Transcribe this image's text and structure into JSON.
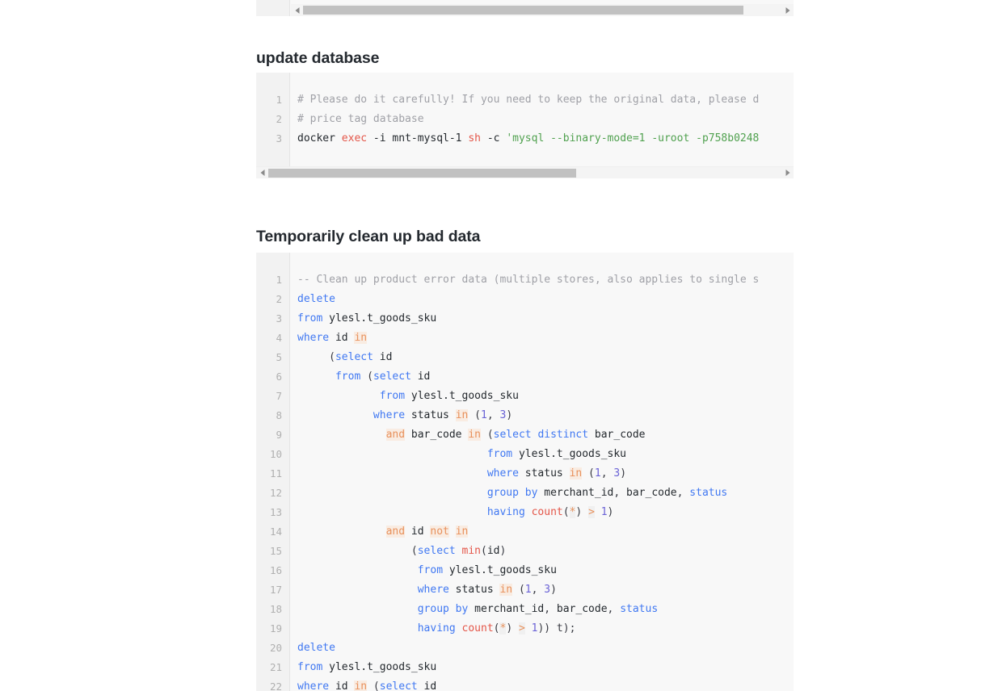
{
  "page": {
    "sections": [
      {
        "id": "update-database",
        "heading": "update database"
      },
      {
        "id": "clean-bad-data",
        "heading": "Temporarily clean up bad data"
      }
    ]
  },
  "top_clipped_block": {
    "scrollbar": {
      "left_arrow": "◀",
      "right_arrow": "▶",
      "thumb_left_pct": 0,
      "thumb_width_pct": 92
    }
  },
  "shell_block": {
    "language": "shell",
    "line_numbers": [
      "1",
      "2",
      "3"
    ],
    "lines": [
      {
        "n": "1",
        "tokens": [
          {
            "t": "# Please do it carefully! If you need to keep the original data, please d",
            "c": "t-comment"
          }
        ]
      },
      {
        "n": "2",
        "tokens": [
          {
            "t": "# price tag database",
            "c": "t-comment"
          }
        ]
      },
      {
        "n": "3",
        "tokens": [
          {
            "t": "docker ",
            "c": "t-plain"
          },
          {
            "t": "exec",
            "c": "t-red"
          },
          {
            "t": " -i mnt-mysql-1 ",
            "c": "t-plain"
          },
          {
            "t": "sh",
            "c": "t-red"
          },
          {
            "t": " -c ",
            "c": "t-plain"
          },
          {
            "t": "'mysql --binary-mode=1 -uroot -p758b0248",
            "c": "t-str"
          }
        ]
      }
    ],
    "scrollbar": {
      "left_arrow": "◀",
      "right_arrow": "▶",
      "thumb_left_pct": 0,
      "thumb_width_pct": 60
    }
  },
  "sql_block": {
    "language": "sql",
    "line_numbers": [
      "1",
      "2",
      "3",
      "4",
      "5",
      "6",
      "7",
      "8",
      "9",
      "10",
      "11",
      "12",
      "13",
      "14",
      "15",
      "16",
      "17",
      "18",
      "19",
      "20",
      "21",
      "22"
    ],
    "lines": [
      {
        "n": "1",
        "tokens": [
          {
            "t": "-- Clean up product error data (multiple stores, also applies to single s",
            "c": "t-comment"
          }
        ]
      },
      {
        "n": "2",
        "tokens": [
          {
            "t": "delete",
            "c": "t-kw"
          }
        ]
      },
      {
        "n": "3",
        "tokens": [
          {
            "t": "from",
            "c": "t-kw"
          },
          {
            "t": " ylesl.t_goods_sku",
            "c": "t-plain"
          }
        ]
      },
      {
        "n": "4",
        "tokens": [
          {
            "t": "where",
            "c": "t-kw"
          },
          {
            "t": " id ",
            "c": "t-plain"
          },
          {
            "t": "in",
            "c": "t-kw-hl"
          }
        ]
      },
      {
        "n": "5",
        "tokens": [
          {
            "t": "     (",
            "c": "t-punc"
          },
          {
            "t": "select",
            "c": "t-kw"
          },
          {
            "t": " id",
            "c": "t-plain"
          }
        ]
      },
      {
        "n": "6",
        "tokens": [
          {
            "t": "      ",
            "c": "t-plain"
          },
          {
            "t": "from",
            "c": "t-kw"
          },
          {
            "t": " (",
            "c": "t-punc"
          },
          {
            "t": "select",
            "c": "t-kw"
          },
          {
            "t": " id",
            "c": "t-plain"
          }
        ]
      },
      {
        "n": "7",
        "tokens": [
          {
            "t": "             ",
            "c": "t-plain"
          },
          {
            "t": "from",
            "c": "t-kw"
          },
          {
            "t": " ylesl.t_goods_sku",
            "c": "t-plain"
          }
        ]
      },
      {
        "n": "8",
        "tokens": [
          {
            "t": "            ",
            "c": "t-plain"
          },
          {
            "t": "where",
            "c": "t-kw"
          },
          {
            "t": " status ",
            "c": "t-plain"
          },
          {
            "t": "in",
            "c": "t-kw-hl"
          },
          {
            "t": " (",
            "c": "t-punc"
          },
          {
            "t": "1",
            "c": "t-num"
          },
          {
            "t": ", ",
            "c": "t-punc"
          },
          {
            "t": "3",
            "c": "t-num"
          },
          {
            "t": ")",
            "c": "t-punc"
          }
        ]
      },
      {
        "n": "9",
        "tokens": [
          {
            "t": "              ",
            "c": "t-plain"
          },
          {
            "t": "and",
            "c": "t-kw-hl"
          },
          {
            "t": " bar_code ",
            "c": "t-plain"
          },
          {
            "t": "in",
            "c": "t-kw-hl"
          },
          {
            "t": " (",
            "c": "t-punc"
          },
          {
            "t": "select distinct",
            "c": "t-kw"
          },
          {
            "t": " bar_code",
            "c": "t-plain"
          }
        ]
      },
      {
        "n": "10",
        "tokens": [
          {
            "t": "                              ",
            "c": "t-plain"
          },
          {
            "t": "from",
            "c": "t-kw"
          },
          {
            "t": " ylesl.t_goods_sku",
            "c": "t-plain"
          }
        ]
      },
      {
        "n": "11",
        "tokens": [
          {
            "t": "                              ",
            "c": "t-plain"
          },
          {
            "t": "where",
            "c": "t-kw"
          },
          {
            "t": " status ",
            "c": "t-plain"
          },
          {
            "t": "in",
            "c": "t-kw-hl"
          },
          {
            "t": " (",
            "c": "t-punc"
          },
          {
            "t": "1",
            "c": "t-num"
          },
          {
            "t": ", ",
            "c": "t-punc"
          },
          {
            "t": "3",
            "c": "t-num"
          },
          {
            "t": ")",
            "c": "t-punc"
          }
        ]
      },
      {
        "n": "12",
        "tokens": [
          {
            "t": "                              ",
            "c": "t-plain"
          },
          {
            "t": "group by",
            "c": "t-kw"
          },
          {
            "t": " merchant_id",
            "c": "t-plain"
          },
          {
            "t": ", ",
            "c": "t-punc"
          },
          {
            "t": "bar_code",
            "c": "t-plain"
          },
          {
            "t": ", ",
            "c": "t-punc"
          },
          {
            "t": "status",
            "c": "t-kw"
          }
        ]
      },
      {
        "n": "13",
        "tokens": [
          {
            "t": "                              ",
            "c": "t-plain"
          },
          {
            "t": "having ",
            "c": "t-kw"
          },
          {
            "t": "count",
            "c": "t-fn"
          },
          {
            "t": "(",
            "c": "t-punc"
          },
          {
            "t": "*",
            "c": "t-op-hl"
          },
          {
            "t": ") ",
            "c": "t-punc"
          },
          {
            "t": ">",
            "c": "t-op-hl"
          },
          {
            "t": " ",
            "c": "t-plain"
          },
          {
            "t": "1",
            "c": "t-num"
          },
          {
            "t": ")",
            "c": "t-punc"
          }
        ]
      },
      {
        "n": "14",
        "tokens": [
          {
            "t": "              ",
            "c": "t-plain"
          },
          {
            "t": "and",
            "c": "t-kw-hl"
          },
          {
            "t": " id ",
            "c": "t-plain"
          },
          {
            "t": "not",
            "c": "t-kw-hl"
          },
          {
            "t": " ",
            "c": "t-plain"
          },
          {
            "t": "in",
            "c": "t-kw-hl"
          }
        ]
      },
      {
        "n": "15",
        "tokens": [
          {
            "t": "                  (",
            "c": "t-punc"
          },
          {
            "t": "select ",
            "c": "t-kw"
          },
          {
            "t": "min",
            "c": "t-fn"
          },
          {
            "t": "(",
            "c": "t-punc"
          },
          {
            "t": "id",
            "c": "t-plain"
          },
          {
            "t": ")",
            "c": "t-punc"
          }
        ]
      },
      {
        "n": "16",
        "tokens": [
          {
            "t": "                   ",
            "c": "t-plain"
          },
          {
            "t": "from",
            "c": "t-kw"
          },
          {
            "t": " ylesl.t_goods_sku",
            "c": "t-plain"
          }
        ]
      },
      {
        "n": "17",
        "tokens": [
          {
            "t": "                   ",
            "c": "t-plain"
          },
          {
            "t": "where",
            "c": "t-kw"
          },
          {
            "t": " status ",
            "c": "t-plain"
          },
          {
            "t": "in",
            "c": "t-kw-hl"
          },
          {
            "t": " (",
            "c": "t-punc"
          },
          {
            "t": "1",
            "c": "t-num"
          },
          {
            "t": ", ",
            "c": "t-punc"
          },
          {
            "t": "3",
            "c": "t-num"
          },
          {
            "t": ")",
            "c": "t-punc"
          }
        ]
      },
      {
        "n": "18",
        "tokens": [
          {
            "t": "                   ",
            "c": "t-plain"
          },
          {
            "t": "group by",
            "c": "t-kw"
          },
          {
            "t": " merchant_id",
            "c": "t-plain"
          },
          {
            "t": ", ",
            "c": "t-punc"
          },
          {
            "t": "bar_code",
            "c": "t-plain"
          },
          {
            "t": ", ",
            "c": "t-punc"
          },
          {
            "t": "status",
            "c": "t-kw"
          }
        ]
      },
      {
        "n": "19",
        "tokens": [
          {
            "t": "                   ",
            "c": "t-plain"
          },
          {
            "t": "having ",
            "c": "t-kw"
          },
          {
            "t": "count",
            "c": "t-fn"
          },
          {
            "t": "(",
            "c": "t-punc"
          },
          {
            "t": "*",
            "c": "t-op-hl"
          },
          {
            "t": ") ",
            "c": "t-punc"
          },
          {
            "t": ">",
            "c": "t-op-hl"
          },
          {
            "t": " ",
            "c": "t-plain"
          },
          {
            "t": "1",
            "c": "t-num"
          },
          {
            "t": ")) t);",
            "c": "t-punc"
          }
        ]
      },
      {
        "n": "20",
        "tokens": [
          {
            "t": "delete",
            "c": "t-kw"
          }
        ]
      },
      {
        "n": "21",
        "tokens": [
          {
            "t": "from",
            "c": "t-kw"
          },
          {
            "t": " ylesl.t_goods_sku",
            "c": "t-plain"
          }
        ]
      },
      {
        "n": "22",
        "tokens": [
          {
            "t": "where",
            "c": "t-kw"
          },
          {
            "t": " id ",
            "c": "t-plain"
          },
          {
            "t": "in",
            "c": "t-kw-hl"
          },
          {
            "t": " (",
            "c": "t-punc"
          },
          {
            "t": "select",
            "c": "t-kw"
          },
          {
            "t": " id",
            "c": "t-plain"
          }
        ]
      }
    ]
  }
}
